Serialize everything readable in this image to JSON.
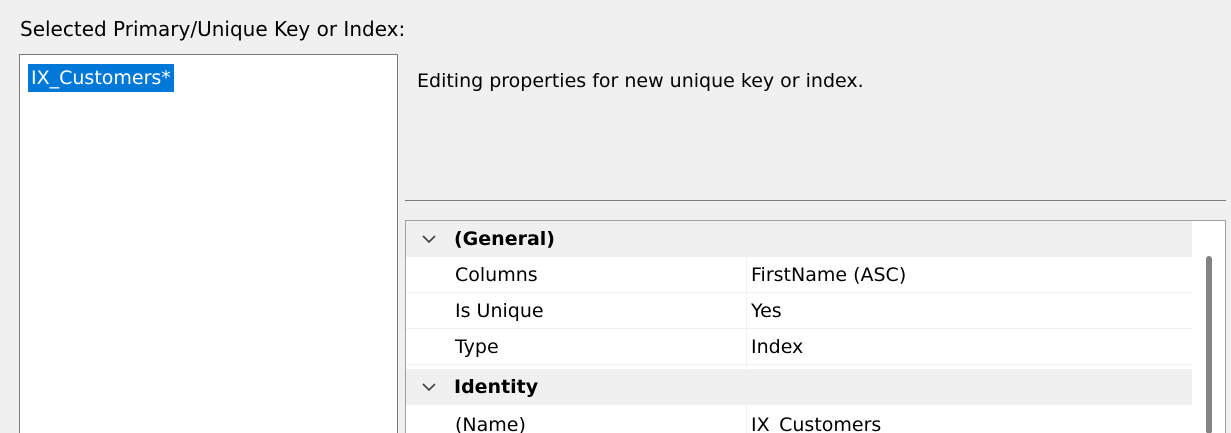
{
  "heading": "Selected Primary/Unique Key or Index:",
  "key_list": {
    "items": [
      {
        "label": "IX_Customers*",
        "selected": true
      }
    ]
  },
  "description": "Editing properties for new unique key or index.",
  "property_grid": {
    "categories": [
      {
        "label": "(General)",
        "expanded": true,
        "properties": [
          {
            "name": "Columns",
            "value": "FirstName (ASC)"
          },
          {
            "name": "Is Unique",
            "value": "Yes"
          },
          {
            "name": "Type",
            "value": "Index"
          }
        ]
      },
      {
        "label": "Identity",
        "expanded": true,
        "properties": [
          {
            "name": "(Name)",
            "value": "IX_Customers"
          }
        ]
      }
    ]
  },
  "colors": {
    "selection": "#0078d7",
    "category_bg": "#f0f0f0",
    "window_bg": "#f0f0f0"
  }
}
